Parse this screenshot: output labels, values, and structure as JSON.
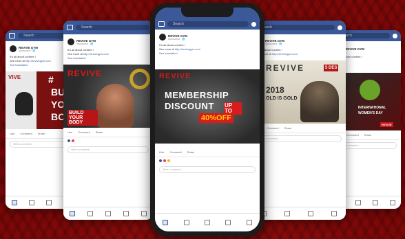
{
  "page": {
    "background_color": "#8e0a0a"
  },
  "facebook": {
    "search_placeholder": "Search",
    "brand_color": "#3b5998"
  },
  "post": {
    "page_name": "REVIVE GYM",
    "meta": "Sponsored · 🌐",
    "line1": "It's all about content !",
    "line2_prefix": "See more at ",
    "link": "http://revivegym.com",
    "see_translation": "See translation",
    "actions": [
      "Like",
      "Comment",
      "Share"
    ],
    "comment_placeholder": "Write a comment..."
  },
  "ads": {
    "far_left": {
      "brand": "VIVE",
      "hashtag": "#",
      "lines": [
        "BU",
        "YO",
        "BO"
      ]
    },
    "left": {
      "brand": "REVIVE",
      "caption": "BUILD YOUR BODY"
    },
    "center": {
      "brand": "REVIVE",
      "line1": "MEMBERSHIP",
      "line2": "DISCOUNT",
      "upto": "UP TO",
      "offer": "40%OFF"
    },
    "right": {
      "brand": "REVIVE",
      "year": "2018",
      "tagline": "OLD IS GOLD",
      "badge": "5 DES"
    },
    "far_right": {
      "line1": "INTERNATIONAL",
      "line2": "WOMEN'S DAY",
      "badge": "REVIVE"
    }
  }
}
